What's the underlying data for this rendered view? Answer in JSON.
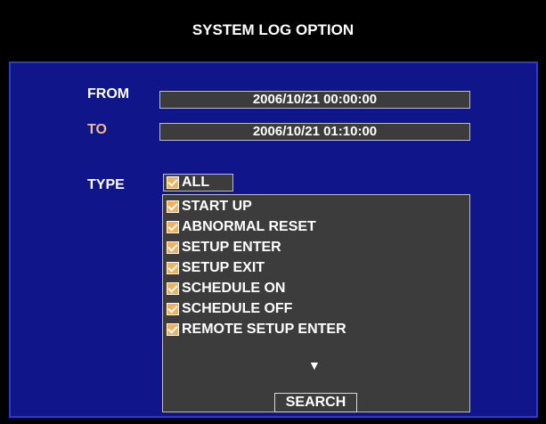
{
  "title": "SYSTEM LOG OPTION",
  "from": {
    "label": "FROM",
    "value": "2006/10/21  00:00:00"
  },
  "to": {
    "label": "TO",
    "value": "2006/10/21  01:10:00"
  },
  "type": {
    "label": "TYPE",
    "all": {
      "label": "ALL",
      "checked": true
    },
    "items": [
      {
        "label": "START UP",
        "checked": true
      },
      {
        "label": "ABNORMAL RESET",
        "checked": true
      },
      {
        "label": "SETUP ENTER",
        "checked": true
      },
      {
        "label": "SETUP EXIT",
        "checked": true
      },
      {
        "label": "SCHEDULE ON",
        "checked": true
      },
      {
        "label": "SCHEDULE OFF",
        "checked": true
      },
      {
        "label": "REMOTE SETUP ENTER",
        "checked": true
      }
    ],
    "more_icon": "down-triangle-icon"
  },
  "search_label": "SEARCH",
  "colors": {
    "panel": "#10168a",
    "to_label": "#f4b98a",
    "checkbox": "#f0b060"
  }
}
